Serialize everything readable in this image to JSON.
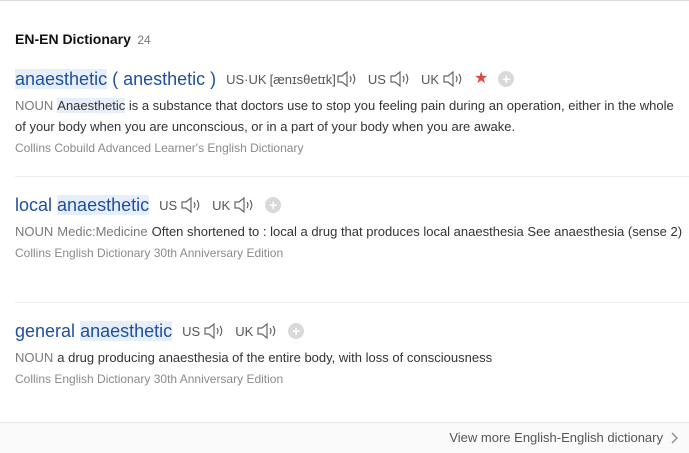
{
  "header": {
    "title": "EN-EN Dictionary",
    "count": "24"
  },
  "entries": [
    {
      "headword_main": "anaesthetic",
      "headword_alt": " ( anesthetic )",
      "pron_us_uk_label": "US·UK",
      "ipa": "[ænɪsθetɪk]",
      "pron_us_label": "US",
      "pron_uk_label": "UK",
      "pos": "NOUN",
      "def_highlight": "Anaesthetic",
      "definition": " is a substance that doctors use to stop you feeling pain during an operation, either in the whole of your body when you are unconscious, or in a part of your body when you are awake.",
      "source": "Collins Cobuild Advanced Learner's English Dictionary"
    },
    {
      "headword_pre": "local ",
      "headword_main": "anaesthetic",
      "pron_us_label": "US",
      "pron_uk_label": "UK",
      "pos": "NOUN",
      "field": "Medic:Medicine",
      "definition": "Often shortened to : local a drug that produces local anaesthesia See anaesthesia (sense 2)",
      "source": "Collins English Dictionary 30th Anniversary Edition"
    },
    {
      "headword_pre": "general ",
      "headword_main": "anaesthetic",
      "pron_us_label": "US",
      "pron_uk_label": "UK",
      "pos": "NOUN",
      "definition": "a drug producing anaesthesia of the entire body, with loss of consciousness",
      "source": "Collins English Dictionary 30th Anniversary Edition"
    }
  ],
  "footer": {
    "more_label": "View more English-English dictionary"
  },
  "icons": {
    "speaker": "speaker-icon",
    "star": "star-icon",
    "add": "add-icon",
    "chevron": "chevron-right-icon"
  },
  "colors": {
    "headword": "#1f4f9e",
    "highlight": "#e5eef9",
    "star": "#e0483b"
  }
}
